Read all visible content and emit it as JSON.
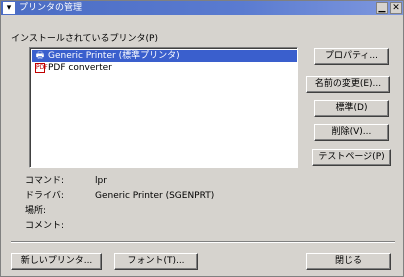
{
  "window": {
    "title": "プリンタの管理",
    "sysmenu_glyph": "▾",
    "minimize_glyph": "▁",
    "close_glyph": "✕"
  },
  "installed_label": "インストールされているプリンタ(P)",
  "printers": [
    {
      "label": "Generic Printer (標準プリンタ)",
      "icon": "printer-icon",
      "icon_glyph": "🖶",
      "selected": true
    },
    {
      "label": "PDF converter",
      "icon": "pdf-icon",
      "icon_glyph": "PDF",
      "selected": false
    }
  ],
  "buttons": {
    "properties": "プロパティ...",
    "rename": "名前の変更(E)...",
    "default": "標準(D)",
    "delete": "削除(V)...",
    "test_page": "テストページ(P)",
    "new_printer": "新しいプリンタ...",
    "fonts": "フォント(T)...",
    "close": "閉じる"
  },
  "details": {
    "command_label": "コマンド:",
    "command_value": "lpr",
    "driver_label": "ドライバ:",
    "driver_value": "Generic Printer (SGENPRT)",
    "location_label": "場所:",
    "location_value": "",
    "comment_label": "コメント:",
    "comment_value": ""
  },
  "colors": {
    "title_bar": "#4b6cc4",
    "selection": "#3a5fcd",
    "pdf_icon": "#c00000"
  }
}
